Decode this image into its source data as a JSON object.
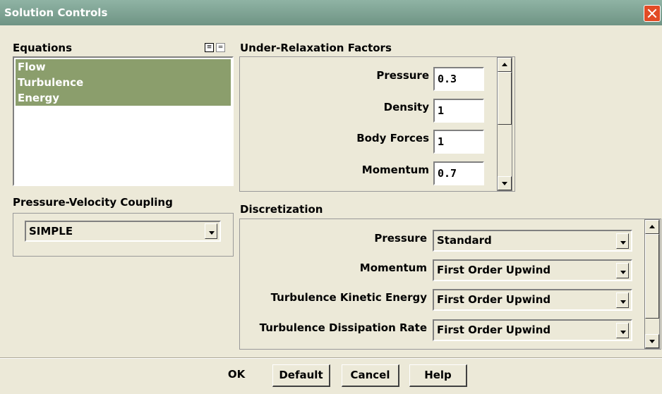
{
  "window": {
    "title": "Solution Controls"
  },
  "equations": {
    "label": "Equations",
    "items": [
      "Flow",
      "Turbulence",
      "Energy"
    ],
    "select_all_glyph": "≡",
    "deselect_all_glyph": "="
  },
  "pv_coupling": {
    "label": "Pressure-Velocity Coupling",
    "value": "SIMPLE"
  },
  "urf": {
    "label": "Under-Relaxation Factors",
    "fields": [
      {
        "label": "Pressure",
        "value": "0.3"
      },
      {
        "label": "Density",
        "value": "1"
      },
      {
        "label": "Body Forces",
        "value": "1"
      },
      {
        "label": "Momentum",
        "value": "0.7"
      }
    ]
  },
  "discretization": {
    "label": "Discretization",
    "fields": [
      {
        "label": "Pressure",
        "value": "Standard"
      },
      {
        "label": "Momentum",
        "value": "First Order Upwind"
      },
      {
        "label": "Turbulence Kinetic Energy",
        "value": "First Order Upwind"
      },
      {
        "label": "Turbulence Dissipation Rate",
        "value": "First Order Upwind"
      }
    ]
  },
  "buttons": {
    "ok": "OK",
    "default": "Default",
    "cancel": "Cancel",
    "help": "Help"
  },
  "icons": {
    "close": "close-icon",
    "scroll_up": "arrow-up-icon",
    "scroll_down": "arrow-down-icon",
    "dropdown": "chevron-down-icon"
  }
}
